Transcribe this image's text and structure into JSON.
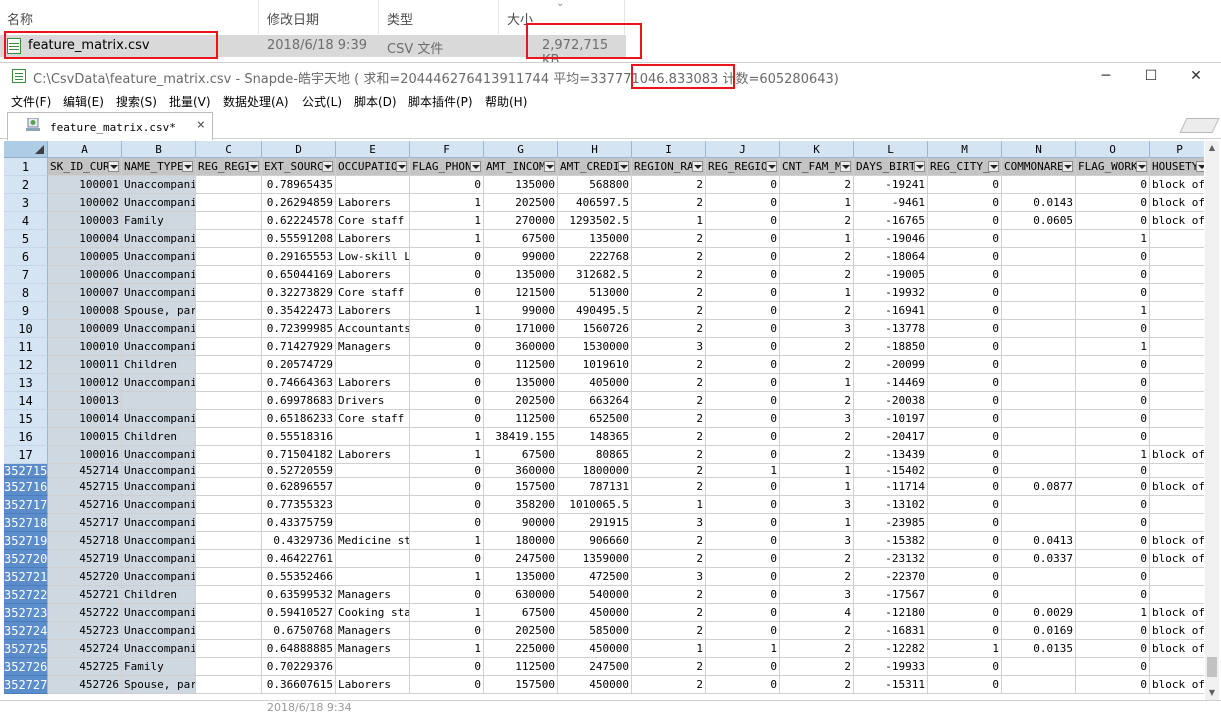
{
  "explorer": {
    "headers": [
      "名称",
      "修改日期",
      "类型",
      "大小"
    ],
    "file": {
      "name": "feature_matrix.csv",
      "date": "2018/6/18 9:39",
      "type": "CSV 文件",
      "size": "2,972,715 KB"
    },
    "next_row_partial": "2018/6/18 9:34"
  },
  "window": {
    "title_path": "C:\\CsvData\\feature_matrix.csv - Snapde-皓宇天地",
    "title_stats": "( 求和=204446276413911744 平均=337771046.833083 ",
    "title_count": "计数=605280643",
    "title_end": ")",
    "btn_min": "─",
    "btn_max": "☐",
    "btn_close": "✕"
  },
  "menu": [
    "文件(F)",
    "编辑(E)",
    "搜索(S)",
    "批量(V)",
    "数据处理(A)",
    "公式(L)",
    "脚本(D)",
    "脚本插件(P)",
    "帮助(H)"
  ],
  "tab": {
    "label": "feature_matrix.csv*",
    "close": "×"
  },
  "columns": {
    "letters": [
      "A",
      "B",
      "C",
      "D",
      "E",
      "F",
      "G",
      "H",
      "I",
      "J",
      "K",
      "L",
      "M",
      "N",
      "O",
      "P"
    ],
    "headers": [
      "SK_ID_CUR",
      "NAME_TYPE",
      "REG_REGIO",
      "EXT_SOURC",
      "OCCUPATIO",
      "FLAG_PHON",
      "AMT_INCOM",
      "AMT_CREDI",
      "REGION_RA",
      "REG_REGIO",
      "CNT_FAM_M",
      "DAYS_BIRT",
      "REG_CITY_",
      "COMMONARE",
      "FLAG_WORK",
      "HOUSETYPE"
    ]
  },
  "rows": [
    {
      "n": "2",
      "v": [
        "100001",
        "Unaccompanie",
        "",
        "0.78965435",
        "",
        "0",
        "135000",
        "568800",
        "2",
        "0",
        "2",
        "-19241",
        "0",
        "",
        "0",
        "block of"
      ]
    },
    {
      "n": "3",
      "v": [
        "100002",
        "Unaccompanie",
        "",
        "0.26294859",
        "Laborers",
        "1",
        "202500",
        "406597.5",
        "2",
        "0",
        "1",
        "-9461",
        "0",
        "0.0143",
        "0",
        "block of"
      ]
    },
    {
      "n": "4",
      "v": [
        "100003",
        "Family",
        "",
        "0.62224578",
        "Core staff",
        "1",
        "270000",
        "1293502.5",
        "1",
        "0",
        "2",
        "-16765",
        "0",
        "0.0605",
        "0",
        "block of"
      ]
    },
    {
      "n": "5",
      "v": [
        "100004",
        "Unaccompanie",
        "",
        "0.55591208",
        "Laborers",
        "1",
        "67500",
        "135000",
        "2",
        "0",
        "1",
        "-19046",
        "0",
        "",
        "1",
        ""
      ]
    },
    {
      "n": "6",
      "v": [
        "100005",
        "Unaccompanie",
        "",
        "0.29165553",
        "Low-skill La",
        "0",
        "99000",
        "222768",
        "2",
        "0",
        "2",
        "-18064",
        "0",
        "",
        "0",
        ""
      ]
    },
    {
      "n": "7",
      "v": [
        "100006",
        "Unaccompanie",
        "",
        "0.65044169",
        "Laborers",
        "0",
        "135000",
        "312682.5",
        "2",
        "0",
        "2",
        "-19005",
        "0",
        "",
        "0",
        ""
      ]
    },
    {
      "n": "8",
      "v": [
        "100007",
        "Unaccompanie",
        "",
        "0.32273829",
        "Core staff",
        "0",
        "121500",
        "513000",
        "2",
        "0",
        "1",
        "-19932",
        "0",
        "",
        "0",
        ""
      ]
    },
    {
      "n": "9",
      "v": [
        "100008",
        "Spouse, part",
        "",
        "0.35422473",
        "Laborers",
        "1",
        "99000",
        "490495.5",
        "2",
        "0",
        "2",
        "-16941",
        "0",
        "",
        "1",
        ""
      ]
    },
    {
      "n": "10",
      "v": [
        "100009",
        "Unaccompanie",
        "",
        "0.72399985",
        "Accountants",
        "0",
        "171000",
        "1560726",
        "2",
        "0",
        "3",
        "-13778",
        "0",
        "",
        "0",
        ""
      ]
    },
    {
      "n": "11",
      "v": [
        "100010",
        "Unaccompanie",
        "",
        "0.71427929",
        "Managers",
        "0",
        "360000",
        "1530000",
        "3",
        "0",
        "2",
        "-18850",
        "0",
        "",
        "1",
        ""
      ]
    },
    {
      "n": "12",
      "v": [
        "100011",
        "Children",
        "",
        "0.20574729",
        "",
        "0",
        "112500",
        "1019610",
        "2",
        "0",
        "2",
        "-20099",
        "0",
        "",
        "0",
        ""
      ]
    },
    {
      "n": "13",
      "v": [
        "100012",
        "Unaccompanie",
        "",
        "0.74664363",
        "Laborers",
        "0",
        "135000",
        "405000",
        "2",
        "0",
        "1",
        "-14469",
        "0",
        "",
        "0",
        ""
      ]
    },
    {
      "n": "14",
      "v": [
        "100013",
        "",
        "",
        "0.69978683",
        "Drivers",
        "0",
        "202500",
        "663264",
        "2",
        "0",
        "2",
        "-20038",
        "0",
        "",
        "0",
        ""
      ]
    },
    {
      "n": "15",
      "v": [
        "100014",
        "Unaccompanie",
        "",
        "0.65186233",
        "Core staff",
        "0",
        "112500",
        "652500",
        "2",
        "0",
        "3",
        "-10197",
        "0",
        "",
        "0",
        ""
      ]
    },
    {
      "n": "16",
      "v": [
        "100015",
        "Children",
        "",
        "0.55518316",
        "",
        "1",
        "38419.155",
        "148365",
        "2",
        "0",
        "2",
        "-20417",
        "0",
        "",
        "0",
        ""
      ]
    },
    {
      "n": "17",
      "v": [
        "100016",
        "Unaccompanie",
        "",
        "0.71504182",
        "Laborers",
        "1",
        "67500",
        "80865",
        "2",
        "0",
        "2",
        "-13439",
        "0",
        "",
        "1",
        "block of"
      ]
    },
    {
      "n": "352715",
      "v": [
        "452714",
        "Unaccompanie",
        "",
        "0.52720559",
        "",
        "0",
        "360000",
        "1800000",
        "2",
        "1",
        "1",
        "-15402",
        "0",
        "",
        "0",
        ""
      ]
    },
    {
      "n": "352716",
      "v": [
        "452715",
        "Unaccompanie",
        "",
        "0.62896557",
        "",
        "0",
        "157500",
        "787131",
        "2",
        "0",
        "1",
        "-11714",
        "0",
        "0.0877",
        "0",
        "block of"
      ]
    },
    {
      "n": "352717",
      "v": [
        "452716",
        "Unaccompanie",
        "",
        "0.77355323",
        "",
        "0",
        "358200",
        "1010065.5",
        "1",
        "0",
        "3",
        "-13102",
        "0",
        "",
        "0",
        ""
      ]
    },
    {
      "n": "352718",
      "v": [
        "452717",
        "Unaccompanie",
        "",
        "0.43375759",
        "",
        "0",
        "90000",
        "291915",
        "3",
        "0",
        "1",
        "-23985",
        "0",
        "",
        "0",
        ""
      ]
    },
    {
      "n": "352719",
      "v": [
        "452718",
        "Unaccompanie",
        "",
        "0.4329736",
        "Medicine sta",
        "1",
        "180000",
        "906660",
        "2",
        "0",
        "3",
        "-15382",
        "0",
        "0.0413",
        "0",
        "block of"
      ]
    },
    {
      "n": "352720",
      "v": [
        "452719",
        "Unaccompanie",
        "",
        "0.46422761",
        "",
        "0",
        "247500",
        "1359000",
        "2",
        "0",
        "2",
        "-23132",
        "0",
        "0.0337",
        "0",
        "block of"
      ]
    },
    {
      "n": "352721",
      "v": [
        "452720",
        "Unaccompanie",
        "",
        "0.55352466",
        "",
        "1",
        "135000",
        "472500",
        "3",
        "0",
        "2",
        "-22370",
        "0",
        "",
        "0",
        ""
      ]
    },
    {
      "n": "352722",
      "v": [
        "452721",
        "Children",
        "",
        "0.63599532",
        "Managers",
        "0",
        "630000",
        "540000",
        "2",
        "0",
        "3",
        "-17567",
        "0",
        "",
        "0",
        ""
      ]
    },
    {
      "n": "352723",
      "v": [
        "452722",
        "Unaccompanie",
        "",
        "0.59410527",
        "Cooking staf",
        "1",
        "67500",
        "450000",
        "2",
        "0",
        "4",
        "-12180",
        "0",
        "0.0029",
        "1",
        "block of"
      ]
    },
    {
      "n": "352724",
      "v": [
        "452723",
        "Unaccompanie",
        "",
        "0.6750768",
        "Managers",
        "0",
        "202500",
        "585000",
        "2",
        "0",
        "2",
        "-16831",
        "0",
        "0.0169",
        "0",
        "block of"
      ]
    },
    {
      "n": "352725",
      "v": [
        "452724",
        "Unaccompanie",
        "",
        "0.64888885",
        "Managers",
        "1",
        "225000",
        "450000",
        "1",
        "1",
        "2",
        "-12282",
        "1",
        "0.0135",
        "0",
        "block of"
      ]
    },
    {
      "n": "352726",
      "v": [
        "452725",
        "Family",
        "",
        "0.70229376",
        "",
        "0",
        "112500",
        "247500",
        "2",
        "0",
        "2",
        "-19933",
        "0",
        "",
        "0",
        ""
      ]
    },
    {
      "n": "352727",
      "v": [
        "452726",
        "Spouse, part",
        "",
        "0.36607615",
        "Laborers",
        "0",
        "157500",
        "450000",
        "2",
        "0",
        "2",
        "-15311",
        "0",
        "",
        "0",
        "block of"
      ]
    }
  ]
}
